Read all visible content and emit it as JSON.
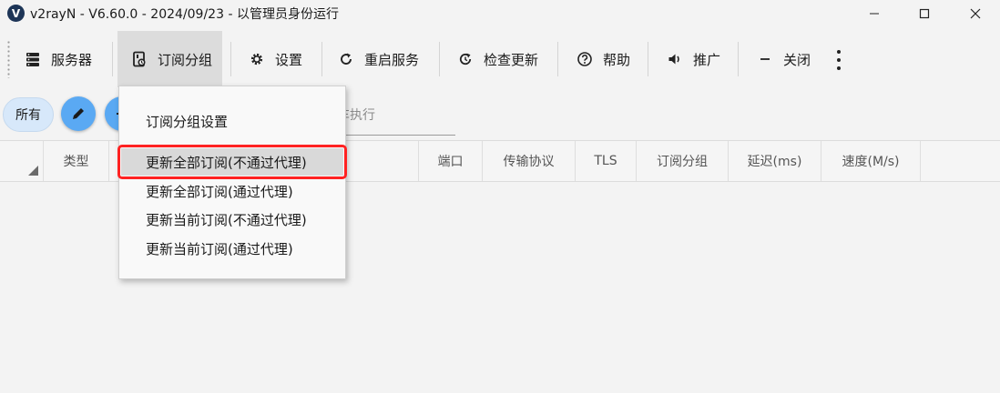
{
  "window": {
    "title": "v2rayN - V6.60.0 - 2024/09/23 - 以管理员身份运行",
    "logo_letter": "V"
  },
  "toolbar": {
    "servers": "服务器",
    "subscription_group": "订阅分组",
    "settings": "设置",
    "restart_service": "重启服务",
    "check_update": "检查更新",
    "help": "帮助",
    "promote": "推广",
    "close": "关闭"
  },
  "filter": {
    "all_label": "所有",
    "search_partial_text": "车执行"
  },
  "table": {
    "columns": [
      "类型",
      "端口",
      "传输协议",
      "TLS",
      "订阅分组",
      "延迟(ms)",
      "速度(M/s)"
    ]
  },
  "menu": {
    "items": [
      "订阅分组设置",
      "更新全部订阅(不通过代理)",
      "更新全部订阅(通过代理)",
      "更新当前订阅(不通过代理)",
      "更新当前订阅(通过代理)"
    ]
  },
  "colors": {
    "accent_fab": "#5aa9f3",
    "chip_bg": "#d7e8fa",
    "highlight": "#ff2222"
  }
}
